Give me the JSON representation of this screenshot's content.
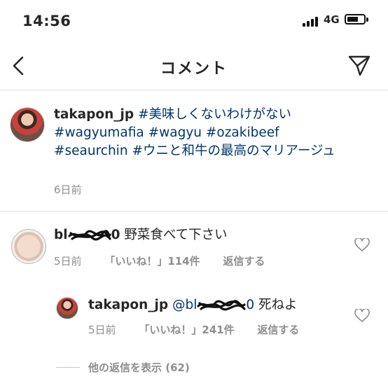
{
  "status_bar": {
    "time": "14:56",
    "network": "4G",
    "battery_level": 0.7
  },
  "nav": {
    "title": "コメント",
    "back_icon": "chevron-left-icon",
    "send_icon": "paper-plane-icon"
  },
  "caption": {
    "username": "takapon_jp",
    "tags": [
      "#美味しくないわけがない",
      "#wagyumafia",
      "#wagyu",
      "#ozakibeef",
      "#seaurchin",
      "#ウニと和牛の最高のマリアージュ"
    ],
    "time": "6日前"
  },
  "comments": [
    {
      "username_prefix": "bl",
      "username_suffix": "0",
      "text": "野菜食べて下さい",
      "time": "5日前",
      "likes": "「いいね！」114件",
      "reply": "返信する"
    }
  ],
  "reply": {
    "username": "takapon_jp",
    "mention_prefix": "@bl",
    "mention_suffix": "0",
    "text": "死ねよ",
    "time": "5日前",
    "likes": "「いいね！」241件",
    "reply": "返信する"
  },
  "more_replies": "他の返信を表示 (62)"
}
